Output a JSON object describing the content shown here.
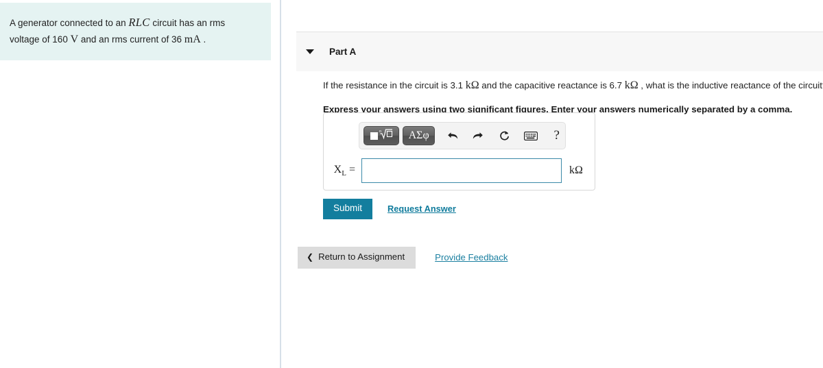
{
  "problem": {
    "text_before_rlc": "A generator connected to an ",
    "rlc": "RLC",
    "text_after_rlc": " circuit has an rms voltage of ",
    "voltage_value": "160",
    "voltage_unit": "V",
    "text_mid": " and an rms current of ",
    "current_value": "36",
    "current_unit": "mA",
    "text_end": "."
  },
  "part": {
    "title": "Part A",
    "collapse_icon": "triangle-down-icon",
    "question_prefix": "If the resistance in the circuit is 3.1 ",
    "question_unit_1": "kΩ",
    "question_mid": " and the capacitive reactance is 6.7 ",
    "question_unit_2": "kΩ",
    "question_suffix": " , what is the inductive reactance of the circuit?",
    "instruction": "Express your answers using two significant figures. Enter your answers numerically separated by a comma."
  },
  "toolbar": {
    "template_button": "template-radical-icon",
    "greek_button": "ΑΣφ",
    "undo_button": "undo-arrow-icon",
    "redo_button": "redo-arrow-icon",
    "reset_button": "reset-circle-icon",
    "keyboard_button": "keyboard-icon",
    "help_button": "?"
  },
  "answer": {
    "label_symbol": "X",
    "label_sub": "L",
    "label_equals": " =",
    "value": "",
    "placeholder": "",
    "unit": "kΩ"
  },
  "actions": {
    "submit_label": "Submit",
    "request_answer_label": "Request Answer",
    "return_chevron": "chevron-left-icon",
    "return_label": "Return to Assignment",
    "provide_feedback_label": "Provide Feedback"
  },
  "colors": {
    "problem_background": "#e5f3f2",
    "accent_teal": "#137e9e",
    "link_teal": "#0f7b9c",
    "input_border": "#3b89a8",
    "part_header_background": "#f7f7f7",
    "return_button_background": "#dcdcdc",
    "divider": "#d6e0e8"
  }
}
